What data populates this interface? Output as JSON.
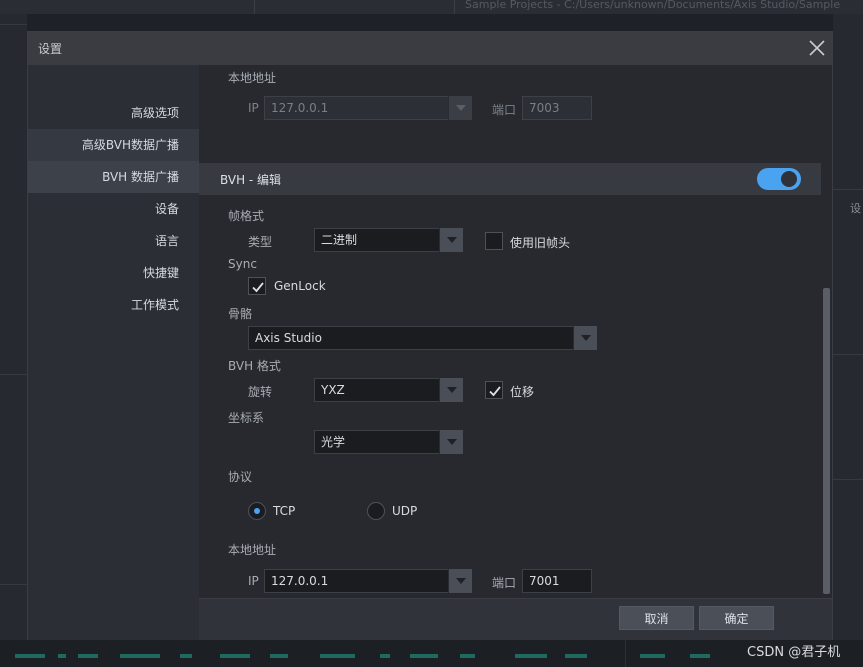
{
  "window": {
    "title": "设置"
  },
  "background": {
    "path_text": "Sample Projects - C:/Users/unknown/Documents/Axis Studio/Sample",
    "right_label": "设"
  },
  "sidebar": {
    "items": [
      {
        "label": "高级选项"
      },
      {
        "label": "高级BVH数据广播"
      },
      {
        "label": "BVH 数据广播"
      },
      {
        "label": "设备"
      },
      {
        "label": "语言"
      },
      {
        "label": "快捷键"
      },
      {
        "label": "工作模式"
      }
    ]
  },
  "top_local": {
    "section_label": "本地地址",
    "ip_label": "IP",
    "ip_value": "127.0.0.1",
    "port_label": "端口",
    "port_value": "7003"
  },
  "bvh_edit": {
    "title": "BVH - 编辑",
    "enabled": true,
    "frame_format_label": "帧格式",
    "type_label": "类型",
    "type_value": "二进制",
    "old_header_label": "使用旧帧头",
    "old_header_checked": false,
    "sync_label": "Sync",
    "genlock_label": "GenLock",
    "genlock_checked": true,
    "skeleton_label": "骨骼",
    "skeleton_value": "Axis Studio",
    "bvh_format_label": "BVH 格式",
    "rotation_label": "旋转",
    "rotation_value": "YXZ",
    "displacement_label": "位移",
    "displacement_checked": true,
    "coord_label": "坐标系",
    "coord_value": "光学",
    "protocol_label": "协议",
    "tcp_label": "TCP",
    "udp_label": "UDP",
    "protocol_selected": "TCP",
    "local_label": "本地地址",
    "ip_label": "IP",
    "ip_value": "127.0.0.1",
    "port_label": "端口",
    "port_value": "7001"
  },
  "footer": {
    "cancel_label": "取消",
    "ok_label": "确定"
  },
  "watermark": "CSDN @君子机",
  "colors": {
    "accent": "#4aa3f0",
    "dialog_bg": "#27292f",
    "titlebar_bg": "#3a3c42"
  }
}
